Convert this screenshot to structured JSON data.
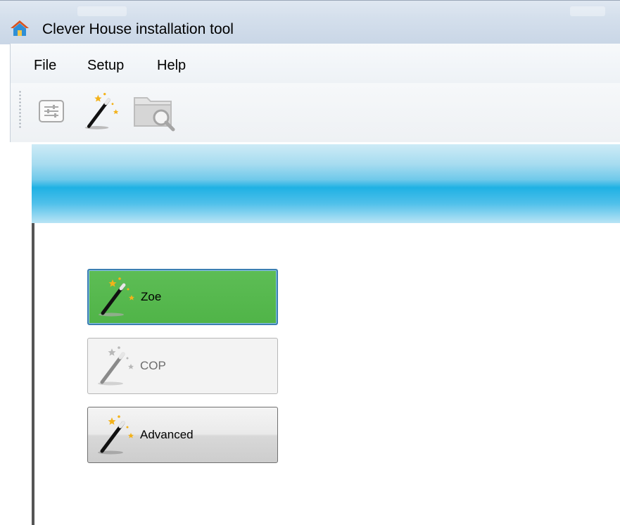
{
  "window": {
    "title": "Clever House installation tool",
    "icon": "house-icon"
  },
  "menu": {
    "items": [
      {
        "label": "File"
      },
      {
        "label": "Setup"
      },
      {
        "label": "Help"
      }
    ]
  },
  "toolbar": {
    "buttons": [
      {
        "icon": "settings-list-icon",
        "enabled": false
      },
      {
        "icon": "magic-wand-icon",
        "enabled": true
      },
      {
        "icon": "folder-search-icon",
        "enabled": false
      }
    ]
  },
  "wizard": {
    "buttons": [
      {
        "label": "Zoe",
        "icon": "magic-wand-icon",
        "state": "selected",
        "color": "#53b54b"
      },
      {
        "label": "COP",
        "icon": "magic-wand-icon",
        "state": "disabled"
      },
      {
        "label": "Advanced",
        "icon": "magic-wand-icon",
        "state": "normal"
      }
    ]
  },
  "colors": {
    "banner": "#1fb1e4",
    "selected_button": "#53b54b",
    "focus_border": "#3c7fb1"
  }
}
